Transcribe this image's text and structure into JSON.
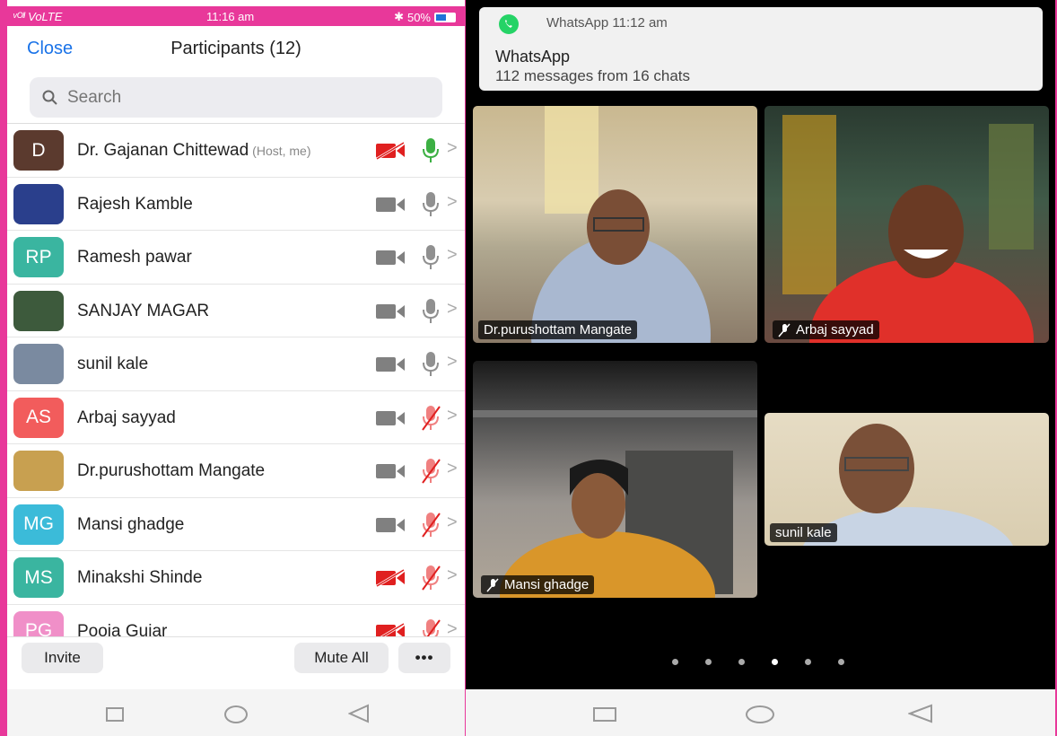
{
  "left_status": {
    "signal": "ᵛᴼˡˡ VoLTE",
    "time": "11:16 am",
    "bt": "✱",
    "battery": "50%"
  },
  "header": {
    "close_label": "Close",
    "title": "Participants (12)"
  },
  "search": {
    "placeholder": "Search"
  },
  "participants": [
    {
      "initials": "D",
      "name": "Dr. Gajanan Chittewad",
      "tag": "(Host, me)",
      "avatar_color": "#5b3a2e",
      "video": "off-red",
      "mic": "on-green"
    },
    {
      "initials": "",
      "name": "Rajesh Kamble",
      "tag": "",
      "avatar_color": "#2a3f8c",
      "video": "on",
      "mic": "on"
    },
    {
      "initials": "RP",
      "name": "Ramesh pawar",
      "tag": "",
      "avatar_color": "#3ab5a0",
      "video": "on",
      "mic": "on"
    },
    {
      "initials": "",
      "name": "SANJAY MAGAR",
      "tag": "",
      "avatar_color": "#3d5a3c",
      "video": "on",
      "mic": "on"
    },
    {
      "initials": "",
      "name": "sunil kale",
      "tag": "",
      "avatar_color": "#7a8aa0",
      "video": "on",
      "mic": "on"
    },
    {
      "initials": "AS",
      "name": "Arbaj sayyad",
      "tag": "",
      "avatar_color": "#f25c5c",
      "video": "on",
      "mic": "muted"
    },
    {
      "initials": "",
      "name": "Dr.purushottam Mangate",
      "tag": "",
      "avatar_color": "#c8a050",
      "video": "on",
      "mic": "muted"
    },
    {
      "initials": "MG",
      "name": "Mansi ghadge",
      "tag": "",
      "avatar_color": "#3bbbd9",
      "video": "on",
      "mic": "muted"
    },
    {
      "initials": "MS",
      "name": "Minakshi Shinde",
      "tag": "",
      "avatar_color": "#3ab5a0",
      "video": "off-red",
      "mic": "muted"
    },
    {
      "initials": "PG",
      "name": "Pooja Gujar",
      "tag": "",
      "avatar_color": "#f08fc8",
      "video": "off-red",
      "mic": "muted"
    }
  ],
  "bottom": {
    "invite_label": "Invite",
    "mute_all_label": "Mute All",
    "more_label": "•••"
  },
  "notification": {
    "app_line": "WhatsApp  11:12 am",
    "title": "WhatsApp",
    "message": "112 messages from 16 chats"
  },
  "video_tiles": [
    {
      "name": "Dr.purushottam Mangate",
      "muted": false
    },
    {
      "name": "Arbaj sayyad",
      "muted": true
    },
    {
      "name": "Mansi ghadge",
      "muted": true
    },
    {
      "name": "sunil kale",
      "muted": false
    }
  ],
  "pager": {
    "pages": 6,
    "active_index": 3
  },
  "colors": {
    "accent": "#1a73e8",
    "danger": "#e02020",
    "active_mic": "#3cb043",
    "frame": "#e8389a"
  }
}
